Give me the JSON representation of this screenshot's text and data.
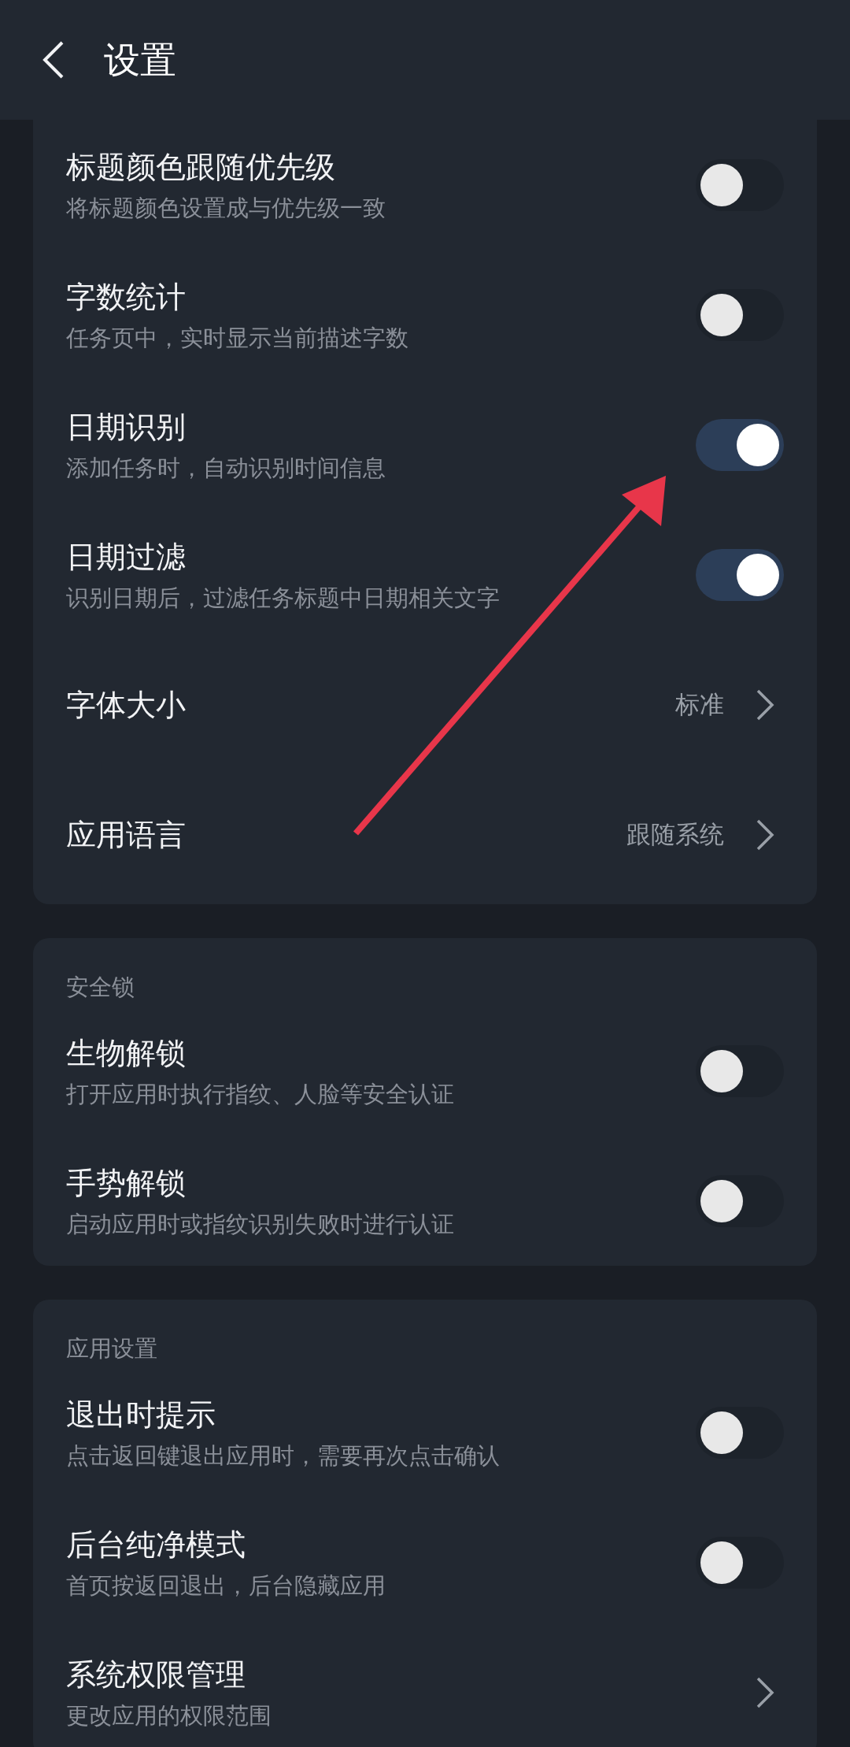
{
  "header": {
    "title": "设置"
  },
  "sections": [
    {
      "items": [
        {
          "kind": "toggle",
          "title": "标题颜色跟随优先级",
          "subtitle": "将标题颜色设置成与优先级一致",
          "on": false
        },
        {
          "kind": "toggle",
          "title": "字数统计",
          "subtitle": "任务页中，实时显示当前描述字数",
          "on": false
        },
        {
          "kind": "toggle",
          "title": "日期识别",
          "subtitle": "添加任务时，自动识别时间信息",
          "on": true
        },
        {
          "kind": "toggle",
          "title": "日期过滤",
          "subtitle": "识别日期后，过滤任务标题中日期相关文字",
          "on": true
        },
        {
          "kind": "link",
          "title": "字体大小",
          "value": "标准"
        },
        {
          "kind": "link",
          "title": "应用语言",
          "value": "跟随系统"
        }
      ]
    },
    {
      "heading": "安全锁",
      "items": [
        {
          "kind": "toggle",
          "title": "生物解锁",
          "subtitle": "打开应用时执行指纹、人脸等安全认证",
          "on": false
        },
        {
          "kind": "toggle",
          "title": "手势解锁",
          "subtitle": "启动应用时或指纹识别失败时进行认证",
          "on": false
        }
      ]
    },
    {
      "heading": "应用设置",
      "items": [
        {
          "kind": "toggle",
          "title": "退出时提示",
          "subtitle": "点击返回键退出应用时，需要再次点击确认",
          "on": false
        },
        {
          "kind": "toggle",
          "title": "后台纯净模式",
          "subtitle": "首页按返回退出，后台隐藏应用",
          "on": false
        },
        {
          "kind": "link",
          "title": "系统权限管理",
          "subtitle": "更改应用的权限范围"
        }
      ]
    }
  ]
}
